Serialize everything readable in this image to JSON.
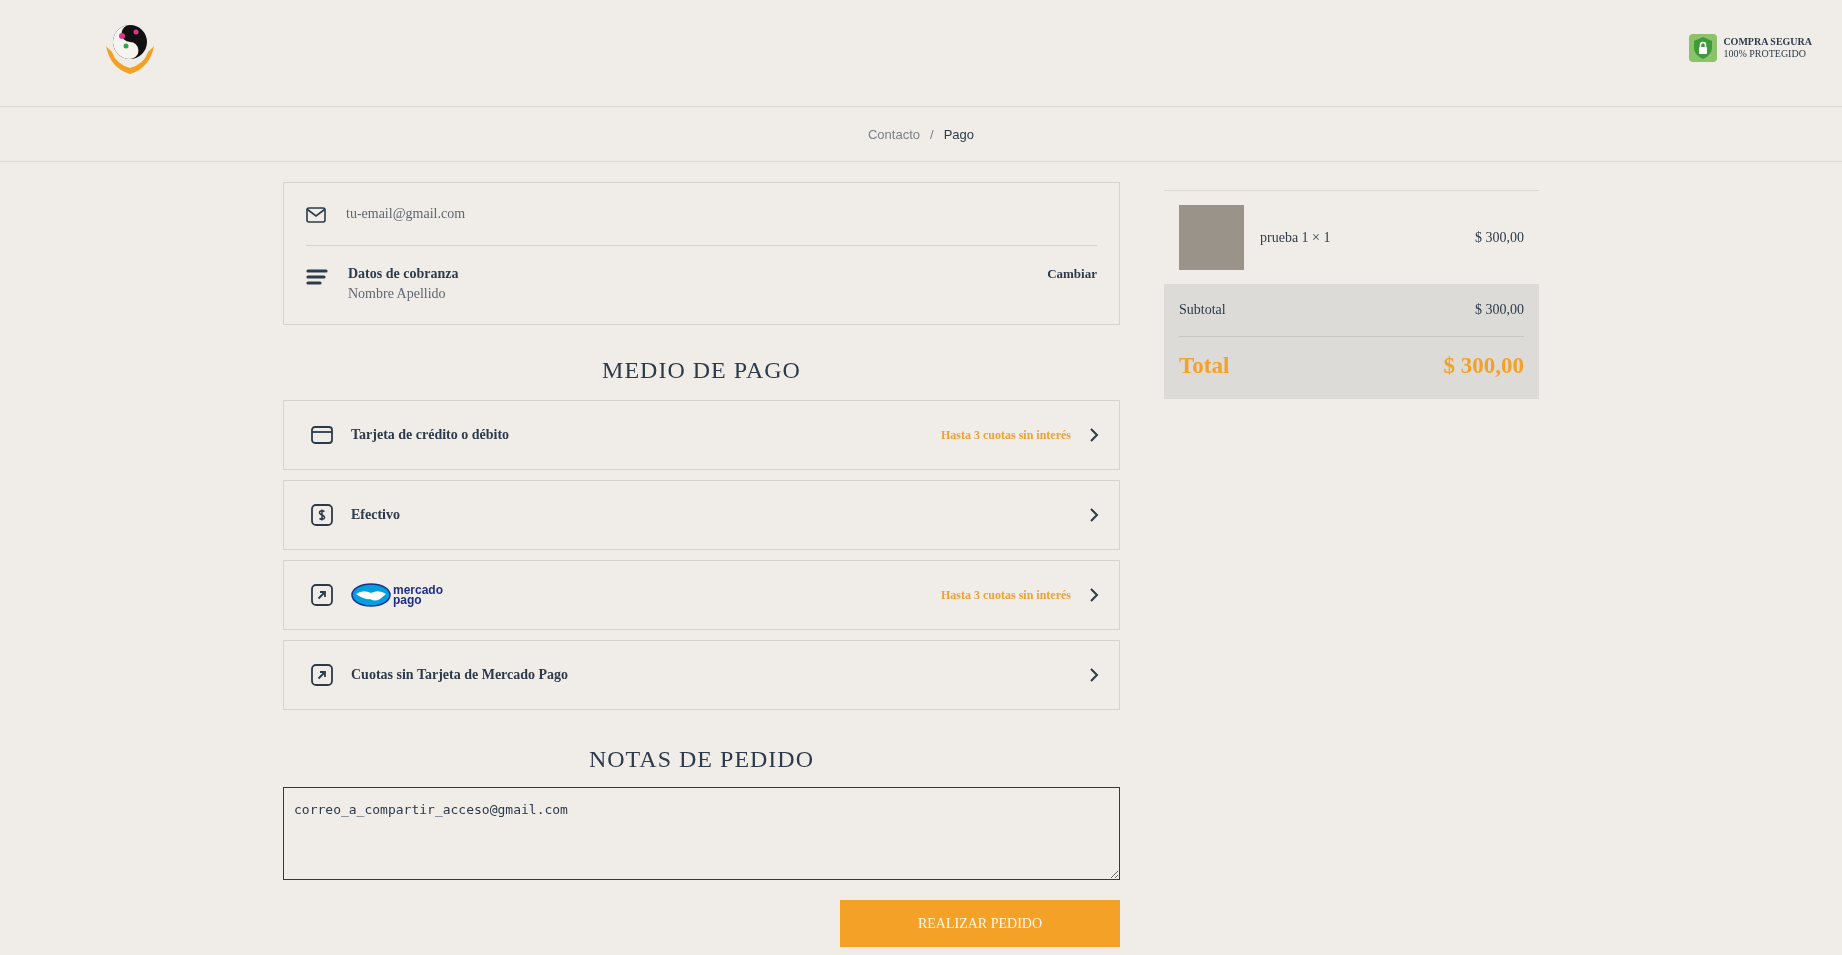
{
  "header": {
    "secure_badge": {
      "title": "COMPRA SEGURA",
      "subtitle": "100% PROTEGIDO"
    }
  },
  "breadcrumb": [
    {
      "label": "Contacto",
      "selected": false
    },
    {
      "separator": "/",
      "label": "Pago",
      "selected": true
    }
  ],
  "contact": {
    "email": "tu-email@gmail.com",
    "billing_title": "Datos de cobranza",
    "billing_name": "Nombre Apellido",
    "change_link": "Cambiar"
  },
  "payment": {
    "heading": "MEDIO DE PAGO",
    "methods": [
      {
        "kind": "card",
        "label": "Tarjeta de crédito o débito",
        "promo": "Hasta 3 cuotas sin interés"
      },
      {
        "kind": "cash",
        "label": "Efectivo"
      },
      {
        "kind": "logo",
        "logo_lines": [
          "mercado",
          "pago"
        ],
        "promo": "Hasta 3 cuotas sin interés"
      },
      {
        "kind": "link",
        "label": "Cuotas sin Tarjeta de Mercado Pago"
      }
    ]
  },
  "notes": {
    "heading": "NOTAS DE PEDIDO",
    "value": "correo_a_compartir_acceso@gmail.com"
  },
  "submit_button": "REALIZAR PEDIDO",
  "cart": {
    "items": [
      {
        "name": "prueba 1 × 1",
        "price": "$ 300,00"
      }
    ],
    "subtotal_label": "Subtotal",
    "subtotal": "$ 300,00",
    "total_label": "Total",
    "total": "$ 300,00"
  }
}
